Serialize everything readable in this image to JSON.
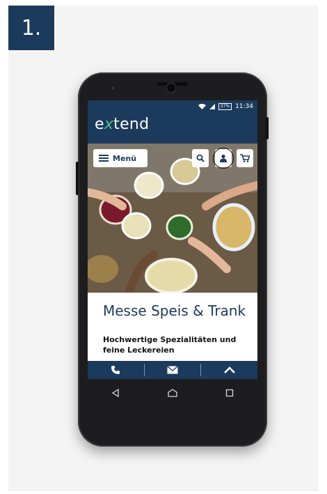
{
  "step_label": "1.",
  "statusbar": {
    "battery": "37%",
    "time": "11:34"
  },
  "brand": {
    "prefix": "e",
    "x": "x",
    "suffix": "tend"
  },
  "header": {
    "menu_label": "Menü"
  },
  "content": {
    "headline": "Messe Speis & Trank",
    "subline": "Hochwertige Spezialitäten und feine Leckereien"
  },
  "icons": {
    "search": "search-icon",
    "user": "user-icon",
    "cart": "cart-icon",
    "phone": "phone-icon",
    "mail": "mail-icon",
    "scroll_top": "chevron-up-icon",
    "back": "back-icon",
    "home": "home-icon",
    "recents": "recents-icon",
    "wifi": "wifi-icon",
    "signal": "signal-icon"
  },
  "colors": {
    "navy": "#1b3a5c",
    "accent_green": "#4cc38a"
  }
}
